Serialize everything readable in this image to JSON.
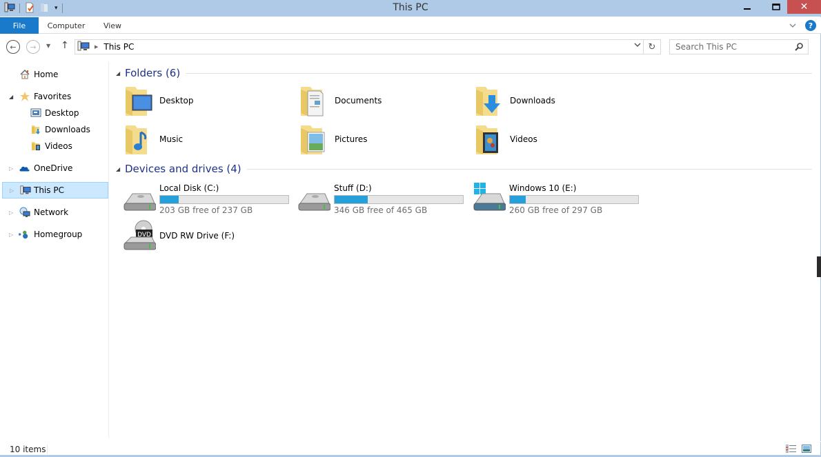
{
  "window": {
    "title": "This PC",
    "controls": {
      "minimize": "–",
      "maximize": "☐",
      "close": "✕"
    }
  },
  "quick_access": {
    "icons": [
      "computer-icon",
      "properties-icon",
      "new-folder-icon",
      "customize-dropdown-icon"
    ]
  },
  "ribbon": {
    "tabs": [
      {
        "label": "File",
        "active": true
      },
      {
        "label": "Computer"
      },
      {
        "label": "View"
      }
    ],
    "help": "?",
    "expand_chevron": "⌄"
  },
  "navigation": {
    "back": "←",
    "forward": "→",
    "recent": "▼",
    "up": "↑",
    "address": {
      "segments": [
        "This PC"
      ],
      "separator": "▶"
    },
    "refresh": "↻",
    "search": {
      "placeholder": "Search This PC",
      "value": ""
    }
  },
  "sidebar": {
    "items": [
      {
        "label": "Home",
        "icon": "home-icon",
        "indent": 0,
        "expander": ""
      },
      {
        "label": "Favorites",
        "icon": "star-icon",
        "indent": 0,
        "expander": "◢"
      },
      {
        "label": "Desktop",
        "icon": "desktop-icon",
        "indent": 1,
        "expander": ""
      },
      {
        "label": "Downloads",
        "icon": "downloads-folder-icon",
        "indent": 1,
        "expander": ""
      },
      {
        "label": "Videos",
        "icon": "videos-folder-icon",
        "indent": 1,
        "expander": ""
      },
      {
        "label": "OneDrive",
        "icon": "onedrive-icon",
        "indent": 0,
        "expander": "▷"
      },
      {
        "label": "This PC",
        "icon": "computer-icon",
        "indent": 0,
        "expander": "▷",
        "selected": true
      },
      {
        "label": "Network",
        "icon": "network-icon",
        "indent": 0,
        "expander": "▷"
      },
      {
        "label": "Homegroup",
        "icon": "homegroup-icon",
        "indent": 0,
        "expander": "▷"
      }
    ]
  },
  "content": {
    "folders_group": {
      "title": "Folders (6)",
      "items": [
        {
          "name": "Desktop",
          "icon": "desktop-folder-icon"
        },
        {
          "name": "Documents",
          "icon": "documents-folder-icon"
        },
        {
          "name": "Downloads",
          "icon": "downloads-folder-icon"
        },
        {
          "name": "Music",
          "icon": "music-folder-icon"
        },
        {
          "name": "Pictures",
          "icon": "pictures-folder-icon"
        },
        {
          "name": "Videos",
          "icon": "videos-folder-icon"
        }
      ]
    },
    "drives_group": {
      "title": "Devices and drives (4)",
      "items": [
        {
          "name": "Local Disk (C:)",
          "icon": "hard-drive-icon",
          "free_gb": 203,
          "total_gb": 237,
          "free_text": "203 GB free of 237 GB"
        },
        {
          "name": "Stuff (D:)",
          "icon": "hard-drive-icon",
          "free_gb": 346,
          "total_gb": 465,
          "free_text": "346 GB free of 465 GB"
        },
        {
          "name": "Windows 10 (E:)",
          "icon": "windows-drive-icon",
          "free_gb": 260,
          "total_gb": 297,
          "free_text": "260 GB free of 297 GB"
        },
        {
          "name": "DVD RW Drive (F:)",
          "icon": "dvd-drive-icon"
        }
      ]
    }
  },
  "status": {
    "item_count": "10 items",
    "views": [
      "details-view-icon",
      "large-icons-view-icon"
    ]
  },
  "colors": {
    "titlebar": "#aecae6",
    "accent": "#1979ca",
    "close": "#c75050",
    "group_title": "#1e3287",
    "drive_fill": "#26a0da",
    "selection": "#cce8ff"
  }
}
